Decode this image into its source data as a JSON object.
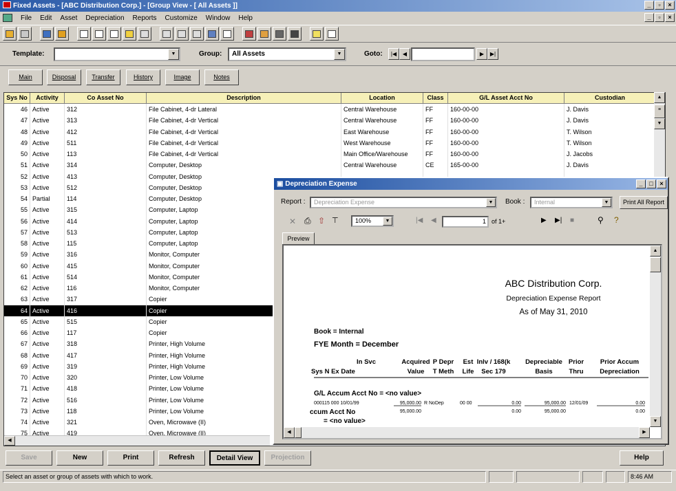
{
  "window": {
    "title": "Fixed Assets - [ABC Distribution Corp.] - [Group View - [ All Assets ]]"
  },
  "menu": [
    "File",
    "Edit",
    "Asset",
    "Depreciation",
    "Reports",
    "Customize",
    "Window",
    "Help"
  ],
  "filters": {
    "template_label": "Template:",
    "template_value": "",
    "group_label": "Group:",
    "group_value": "All Assets",
    "goto_label": "Goto:",
    "goto_value": ""
  },
  "tabs": [
    "Main",
    "Disposal",
    "Transfer",
    "History",
    "Image",
    "Notes"
  ],
  "grid": {
    "headers": [
      "Sys No",
      "Activity",
      "Co Asset No",
      "Description",
      "Location",
      "Class",
      "G/L Asset Acct No",
      "Custodian"
    ],
    "rows": [
      [
        "46",
        "Active",
        "312",
        "File Cabinet, 4-dr Lateral",
        "Central Warehouse",
        "FF",
        "160-00-00",
        "J. Davis"
      ],
      [
        "47",
        "Active",
        "313",
        "File Cabinet, 4-dr Vertical",
        "Central Warehouse",
        "FF",
        "160-00-00",
        "J. Davis"
      ],
      [
        "48",
        "Active",
        "412",
        "File Cabinet, 4-dr Vertical",
        "East Warehouse",
        "FF",
        "160-00-00",
        "T. Wilson"
      ],
      [
        "49",
        "Active",
        "511",
        "File Cabinet, 4-dr Vertical",
        "West Warehouse",
        "FF",
        "160-00-00",
        "T. Wilson"
      ],
      [
        "50",
        "Active",
        "113",
        "File Cabinet, 4-dr Vertical",
        "Main Office/Warehouse",
        "FF",
        "160-00-00",
        "J. Jacobs"
      ],
      [
        "51",
        "Active",
        "314",
        "Computer, Desktop",
        "Central Warehouse",
        "CE",
        "165-00-00",
        "J. Davis"
      ],
      [
        "52",
        "Active",
        "413",
        "Computer, Desktop",
        "",
        "",
        "",
        ""
      ],
      [
        "53",
        "Active",
        "512",
        "Computer, Desktop",
        "",
        "",
        "",
        ""
      ],
      [
        "54",
        "Partial",
        "114",
        "Computer, Desktop",
        "",
        "",
        "",
        ""
      ],
      [
        "55",
        "Active",
        "315",
        "Computer, Laptop",
        "",
        "",
        "",
        ""
      ],
      [
        "56",
        "Active",
        "414",
        "Computer, Laptop",
        "",
        "",
        "",
        ""
      ],
      [
        "57",
        "Active",
        "513",
        "Computer, Laptop",
        "",
        "",
        "",
        ""
      ],
      [
        "58",
        "Active",
        "115",
        "Computer, Laptop",
        "",
        "",
        "",
        ""
      ],
      [
        "59",
        "Active",
        "316",
        "Monitor, Computer",
        "",
        "",
        "",
        ""
      ],
      [
        "60",
        "Active",
        "415",
        "Monitor, Computer",
        "",
        "",
        "",
        ""
      ],
      [
        "61",
        "Active",
        "514",
        "Monitor, Computer",
        "",
        "",
        "",
        ""
      ],
      [
        "62",
        "Active",
        "116",
        "Monitor, Computer",
        "",
        "",
        "",
        ""
      ],
      [
        "63",
        "Active",
        "317",
        "Copier",
        "",
        "",
        "",
        ""
      ],
      [
        "64",
        "Active",
        "416",
        "Copier",
        "",
        "",
        "",
        ""
      ],
      [
        "65",
        "Active",
        "515",
        "Copier",
        "",
        "",
        "",
        ""
      ],
      [
        "66",
        "Active",
        "117",
        "Copier",
        "",
        "",
        "",
        ""
      ],
      [
        "67",
        "Active",
        "318",
        "Printer, High Volume",
        "",
        "",
        "",
        ""
      ],
      [
        "68",
        "Active",
        "417",
        "Printer, High Volume",
        "",
        "",
        "",
        ""
      ],
      [
        "69",
        "Active",
        "319",
        "Printer, High Volume",
        "",
        "",
        "",
        ""
      ],
      [
        "70",
        "Active",
        "320",
        "Printer, Low Volume",
        "",
        "",
        "",
        ""
      ],
      [
        "71",
        "Active",
        "418",
        "Printer, Low Volume",
        "",
        "",
        "",
        ""
      ],
      [
        "72",
        "Active",
        "516",
        "Printer, Low Volume",
        "",
        "",
        "",
        ""
      ],
      [
        "73",
        "Active",
        "118",
        "Printer, Low Volume",
        "",
        "",
        "",
        ""
      ],
      [
        "74",
        "Active",
        "321",
        "Oven, Microwave (II)",
        "",
        "",
        "",
        ""
      ],
      [
        "75",
        "Active",
        "419",
        "Oven, Microwave (II)",
        "",
        "",
        "",
        ""
      ]
    ]
  },
  "dialog": {
    "title": "Depreciation Expense",
    "report_label": "Report :",
    "report_value": "Depreciation Expense",
    "book_label": "Book :",
    "book_value": "Internal",
    "print_all": "Print All Report",
    "zoom": "100%",
    "page_value": "1",
    "page_of": "of 1+",
    "preview_tab": "Preview",
    "paper": {
      "company": "ABC Distribution Corp.",
      "report_title": "Depreciation Expense Report",
      "as_of": "As of May 31, 2010",
      "book_line": "Book = Internal",
      "fye_line": "FYE Month = December",
      "col_headers_top": [
        "In Svc",
        "Acquired",
        "P Depr",
        "Est",
        "Inlv / 168(k",
        "Depreciable",
        "Prior",
        "Prior Accum"
      ],
      "col_headers_bot": [
        "Sys N Ex Date",
        "Value",
        "T Meth",
        "Life",
        "Sec 179",
        "Basis",
        "Thru",
        "Depreciation"
      ],
      "group_line": "G/L Accum Acct No = <no value>",
      "detail_line": [
        "000115  000  10/01/99",
        "95,000.00",
        "R  NoDep",
        "00  00",
        "0.00",
        "95,000.00",
        "12/01/09",
        "0.00"
      ],
      "subtotal_label_1": "ccum Acct No",
      "subtotal_label_2": "= <no value>",
      "subtotal_values": [
        "95,000.00",
        "0.00",
        "95,000.00",
        "0.00"
      ]
    }
  },
  "buttons": [
    "Save",
    "New",
    "Print",
    "Refresh",
    "Detail View",
    "Projection",
    "Help"
  ],
  "status": {
    "message": "Select an asset or group of assets with which to work.",
    "time": "8:46 AM"
  }
}
